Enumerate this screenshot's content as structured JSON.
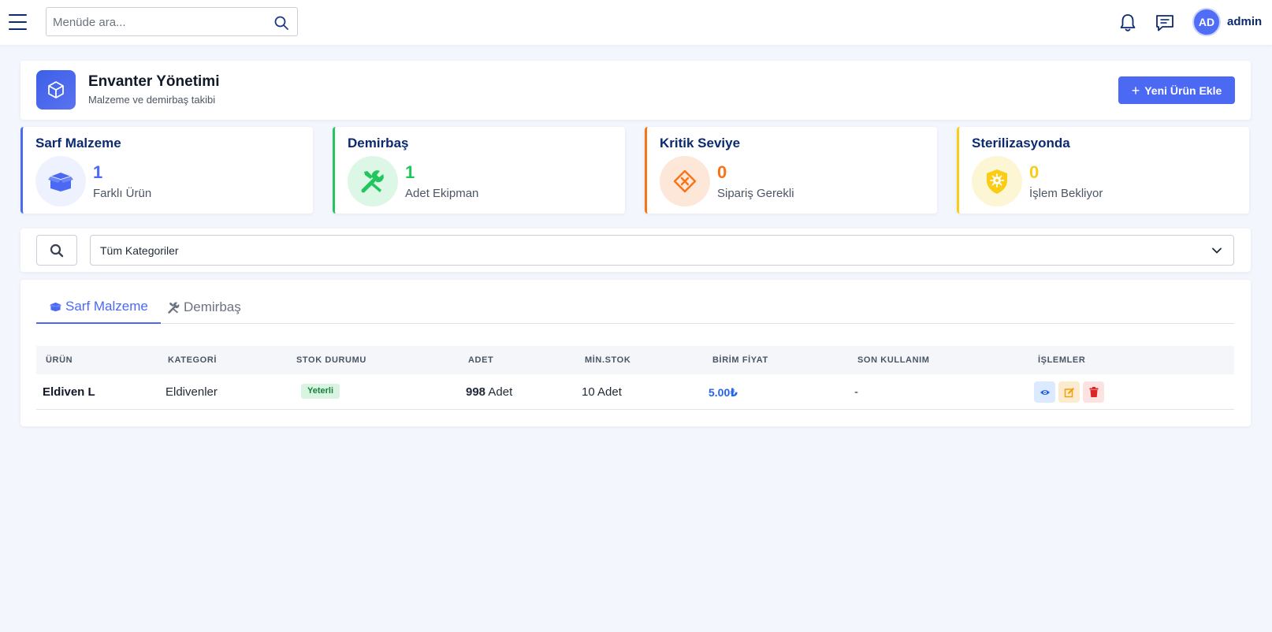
{
  "topbar": {
    "search_placeholder": "Menüde ara...",
    "avatar_initials": "AD",
    "username": "admin"
  },
  "header": {
    "title": "Envanter Yönetimi",
    "subtitle": "Malzeme ve demirbaş takibi",
    "add_button": "Yeni Ürün Ekle"
  },
  "stats": [
    {
      "label": "Sarf Malzeme",
      "value": "1",
      "caption": "Farklı Ürün",
      "accent": "#4b69f3",
      "icon": "box-open-icon"
    },
    {
      "label": "Demirbaş",
      "value": "1",
      "caption": "Adet Ekipman",
      "accent": "#22c55e",
      "icon": "tools-icon"
    },
    {
      "label": "Kritik Seviye",
      "value": "0",
      "caption": "Sipariş Gerekli",
      "accent": "#f97316",
      "icon": "warning-diamond-icon"
    },
    {
      "label": "Sterilizasyonda",
      "value": "0",
      "caption": "İşlem Bekliyor",
      "accent": "#facc15",
      "icon": "virus-shield-icon"
    }
  ],
  "filter": {
    "category_selected": "Tüm Kategoriler"
  },
  "tabs": [
    {
      "label": "Sarf Malzeme",
      "active": true
    },
    {
      "label": "Demirbaş",
      "active": false
    }
  ],
  "table": {
    "columns": [
      "ÜRÜN",
      "KATEGORİ",
      "STOK DURUMU",
      "ADET",
      "MİN.STOK",
      "BİRİM FİYAT",
      "SON KULLANIM",
      "İŞLEMLER"
    ],
    "rows": [
      {
        "product": "Eldiven L",
        "category": "Eldivenler",
        "status": "Yeterli",
        "qty": "998",
        "qty_unit": "Adet",
        "min_stock": "10 Adet",
        "price": "5.00₺",
        "expiry": "-"
      }
    ]
  }
}
